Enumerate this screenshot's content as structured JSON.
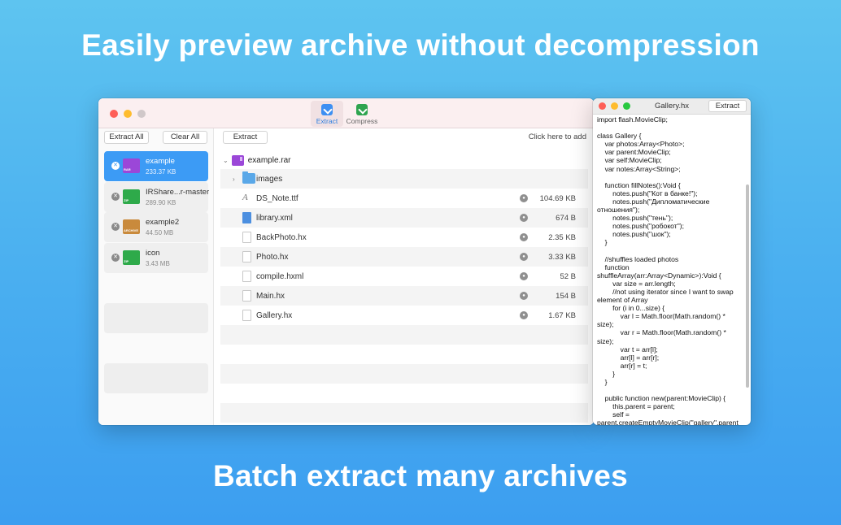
{
  "headlines": {
    "top": "Easily preview archive without decompression",
    "bottom": "Batch extract many archives"
  },
  "toolbar": {
    "extract_label": "Extract",
    "compress_label": "Compress"
  },
  "sidebar": {
    "extract_all_label": "Extract All",
    "clear_all_label": "Clear All",
    "items": [
      {
        "name": "example",
        "size": "233.37 KB",
        "badge": "RAR",
        "color": "#9b47d8"
      },
      {
        "name": "IRShare...r-master",
        "size": "289.90 KB",
        "badge": "ZIP",
        "color": "#2eaa4a"
      },
      {
        "name": "example2",
        "size": "44.50 MB",
        "badge": "ARCHIVE",
        "color": "#c98a3c"
      },
      {
        "name": "icon",
        "size": "3.43 MB",
        "badge": "ZIP",
        "color": "#2eaa4a"
      }
    ]
  },
  "content": {
    "extract_label": "Extract",
    "hint": "Click here to add",
    "root_name": "example.rar",
    "files": [
      {
        "name": "images",
        "size": ""
      },
      {
        "name": "DS_Note.ttf",
        "size": "104.69 KB"
      },
      {
        "name": "library.xml",
        "size": "674 B"
      },
      {
        "name": "BackPhoto.hx",
        "size": "2.35 KB"
      },
      {
        "name": "Photo.hx",
        "size": "3.33 KB"
      },
      {
        "name": "compile.hxml",
        "size": "52 B"
      },
      {
        "name": "Main.hx",
        "size": "154 B"
      },
      {
        "name": "Gallery.hx",
        "size": "1.67 KB"
      }
    ]
  },
  "code_window": {
    "title": "Gallery.hx",
    "extract_label": "Extract",
    "code": "import flash.MovieClip;\n\nclass Gallery {\n    var photos:Array<Photo>;\n    var parent:MovieClip;\n    var self:MovieClip;\n    var notes:Array<String>;\n\n    function fillNotes():Void {\n        notes.push(\"Кот в банке!\");\n        notes.push(\"Дипломатические отношения\");\n        notes.push(\"тень\");\n        notes.push(\"робокот\");\n        notes.push(\"шок\");\n    }\n\n    //shuffles loaded photos\n    function shuffleArray(arr:Array<Dynamic>):Void {\n        var size = arr.length;\n        //not using iterator since I want to swap element of Array\n        for (i in 0...size) {\n            var l = Math.floor(Math.random() * size);\n            var r = Math.floor(Math.random() * size);\n            var t = arr[l];\n            arr[l] = arr[r];\n            arr[r] = t;\n        }\n    }\n\n    public function new(parent:MovieClip) {\n        this.parent = parent;\n        self = parent.createEmptyMovieClip(\"gallery\",parent"
  }
}
